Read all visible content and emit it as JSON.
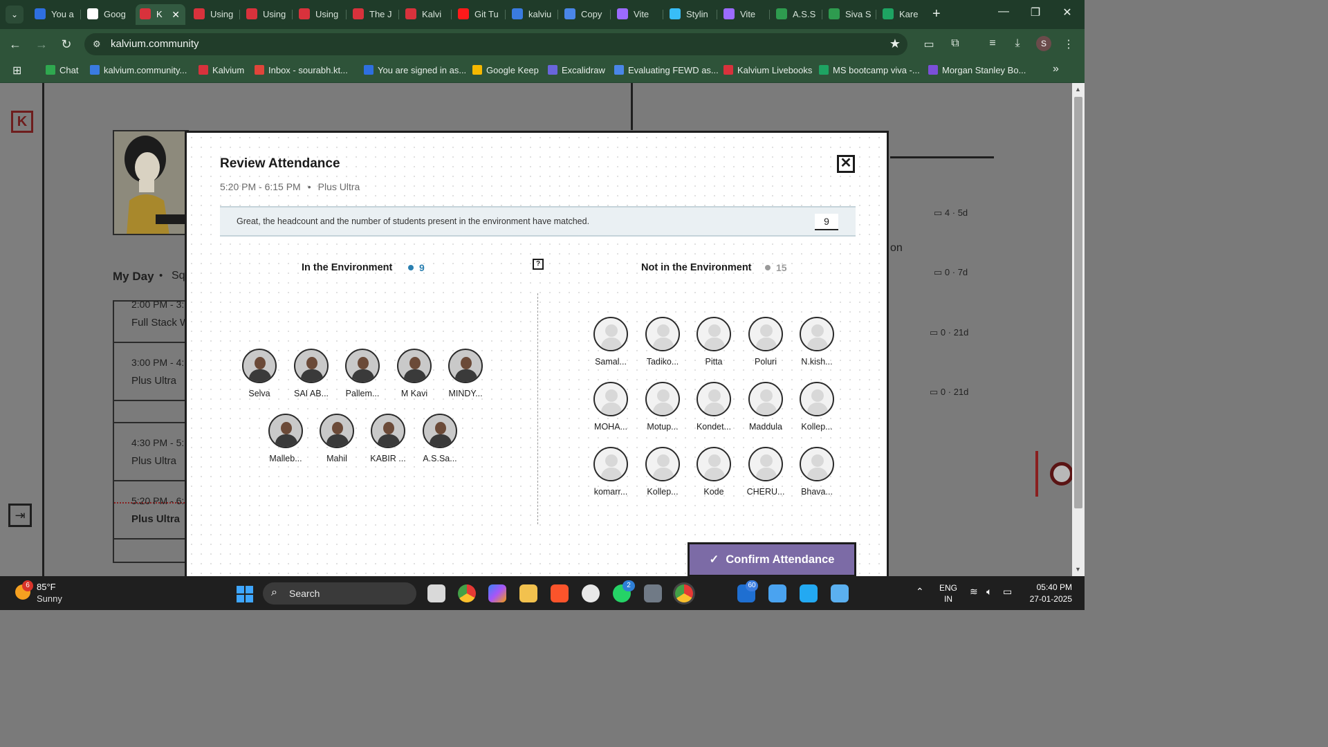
{
  "browser": {
    "tabs": [
      {
        "label": "You a",
        "color": "#2e6fe0"
      },
      {
        "label": "Goog",
        "color": "#ffffff"
      },
      {
        "label": "K",
        "color": "#d8323c",
        "active": true
      },
      {
        "label": "Using",
        "color": "#d8323c"
      },
      {
        "label": "Using",
        "color": "#d8323c"
      },
      {
        "label": "Using",
        "color": "#d8323c"
      },
      {
        "label": "The J",
        "color": "#d8323c"
      },
      {
        "label": "Kalvi",
        "color": "#d8323c"
      },
      {
        "label": "Git Tu",
        "color": "#ff1a1a"
      },
      {
        "label": "kalviu",
        "color": "#3a7be0"
      },
      {
        "label": "Copy",
        "color": "#4a86e8"
      },
      {
        "label": "Vite",
        "color": "#9b6bff"
      },
      {
        "label": "Stylin",
        "color": "#38bdf8"
      },
      {
        "label": "Vite",
        "color": "#9b6bff"
      },
      {
        "label": "A.S.S",
        "color": "#2e9b4f"
      },
      {
        "label": "Siva S",
        "color": "#2e9b4f"
      },
      {
        "label": "Kare",
        "color": "#1ea362"
      }
    ],
    "url": "kalvium.community",
    "profile_initial": "S",
    "bookmarks": [
      {
        "label": "Chat",
        "color": "#2fa84f"
      },
      {
        "label": "kalvium.community...",
        "color": "#3a7be0"
      },
      {
        "label": "Kalvium",
        "color": "#d8323c"
      },
      {
        "label": "Inbox - sourabh.kt...",
        "color": "#e0453a"
      },
      {
        "label": "You are signed in as...",
        "color": "#2e6fe0"
      },
      {
        "label": "Google Keep",
        "color": "#f5b800"
      },
      {
        "label": "Excalidraw",
        "color": "#6965db"
      },
      {
        "label": "Evaluating FEWD as...",
        "color": "#4a86e8"
      },
      {
        "label": "Kalvium Livebooks",
        "color": "#d8323c"
      },
      {
        "label": "MS bootcamp viva -...",
        "color": "#1ea362"
      },
      {
        "label": "Morgan Stanley Bo...",
        "color": "#7b4fd8"
      }
    ]
  },
  "background": {
    "my_day": "My Day",
    "my_day_suffix": "Sq",
    "schedule": [
      {
        "time": "2:00 PM - 3:",
        "title": "Full Stack W"
      },
      {
        "time": "3:00 PM - 4:",
        "title": "Plus Ultra"
      },
      {
        "time": "4:30 PM - 5:",
        "title": "Plus Ultra"
      },
      {
        "time": "5:20 PM - 6:",
        "title": "Plus Ultra"
      }
    ],
    "right_partial_text": "on",
    "activity": [
      {
        "comments": "4",
        "age": "5d"
      },
      {
        "comments": "0",
        "age": "7d"
      },
      {
        "comments": "0",
        "age": "21d"
      },
      {
        "comments": "0",
        "age": "21d"
      }
    ]
  },
  "modal": {
    "title": "Review Attendance",
    "time": "5:20 PM - 6:15 PM",
    "session": "Plus Ultra",
    "banner_text": "Great, the headcount and the number of students present in the environment have matched.",
    "headcount": "9",
    "in_env_label": "In the Environment",
    "in_env_count": "9",
    "not_in_env_label": "Not in the Environment",
    "not_in_env_count": "15",
    "present": [
      "Selva",
      "SAI AB...",
      "Pallem...",
      "M Kavi",
      "MINDY...",
      "Malleb...",
      "Mahil",
      "KABIR ...",
      "A.S.Sa..."
    ],
    "absent": [
      "Samal...",
      "Tadiko...",
      "Pitta",
      "Poluri",
      "N.kish...",
      "MOHA...",
      "Motup...",
      "Kondet...",
      "Maddula",
      "Kollep...",
      "komarr...",
      "Kollep...",
      "Kode",
      "CHERU...",
      "Bhava..."
    ],
    "confirm_label": "Confirm Attendance",
    "colors": {
      "in_env": "#2a7fb0",
      "not_in_env": "#9a9a9a",
      "confirm": "#7c6ba6"
    }
  },
  "taskbar": {
    "weather_badge": "6",
    "temperature": "85°F",
    "condition": "Sunny",
    "search_placeholder": "Search",
    "whatsapp_badge": "2",
    "mail_badge": "60",
    "language": "ENG",
    "region": "IN",
    "time": "05:40 PM",
    "date": "27-01-2025"
  }
}
